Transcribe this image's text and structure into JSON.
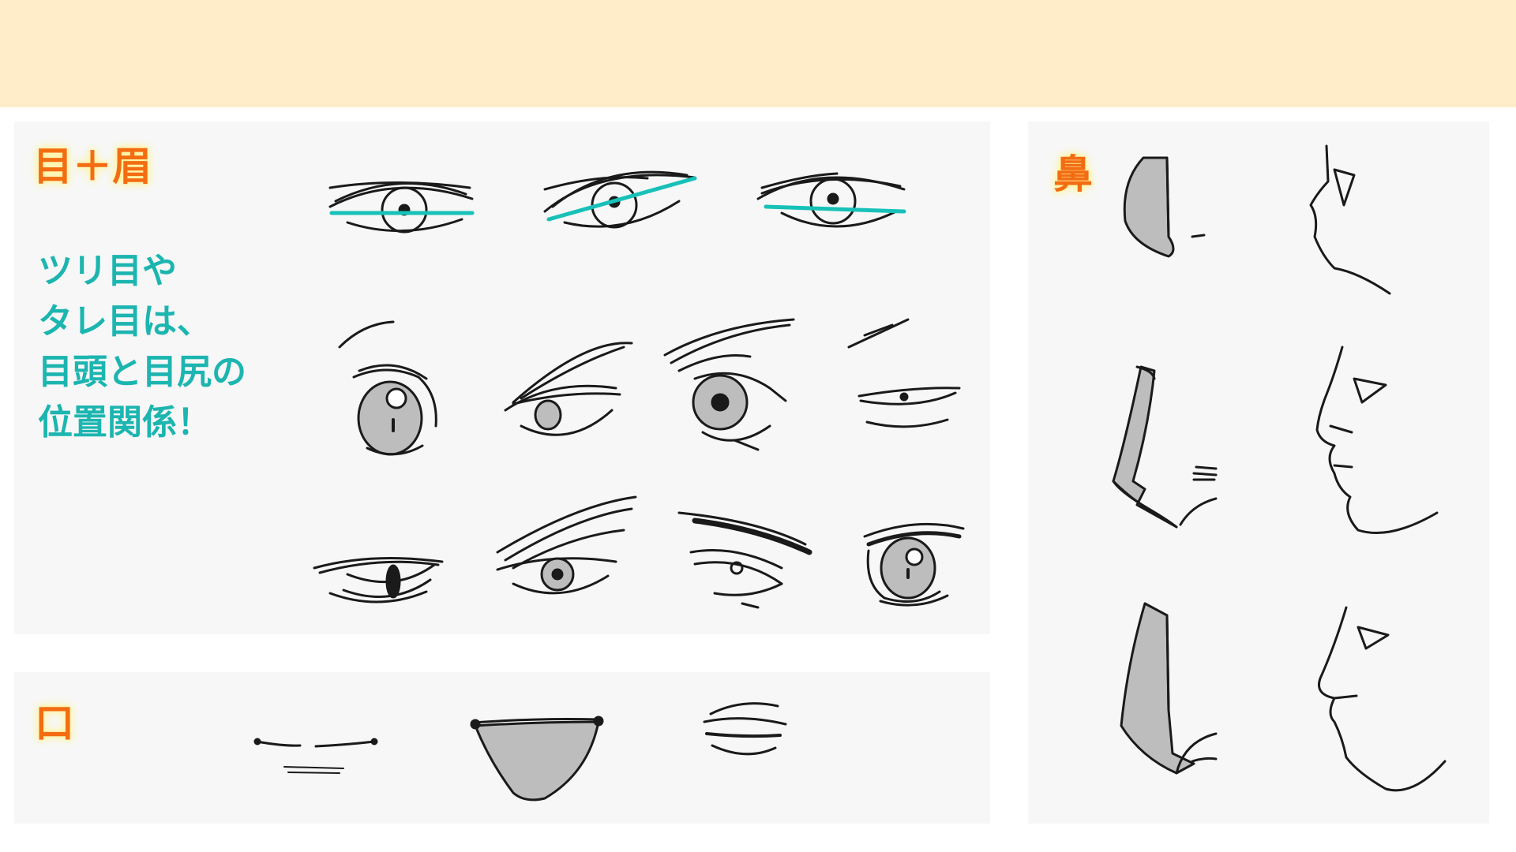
{
  "labels": {
    "eyes": "目＋眉",
    "mouth": "口",
    "nose": "鼻"
  },
  "tip_text": "ツリ目や\nタレ目は、\n目頭と目尻の\n位置関係！",
  "colors": {
    "banner": "#ffecc9",
    "panel": "#f7f7f7",
    "label": "#f36c12",
    "label_glow": "#fff3a0",
    "tip": "#1cb5b0",
    "guide_line": "#17c1b8",
    "ink": "#1a1a1a",
    "fill_gray": "#bdbdbd"
  }
}
